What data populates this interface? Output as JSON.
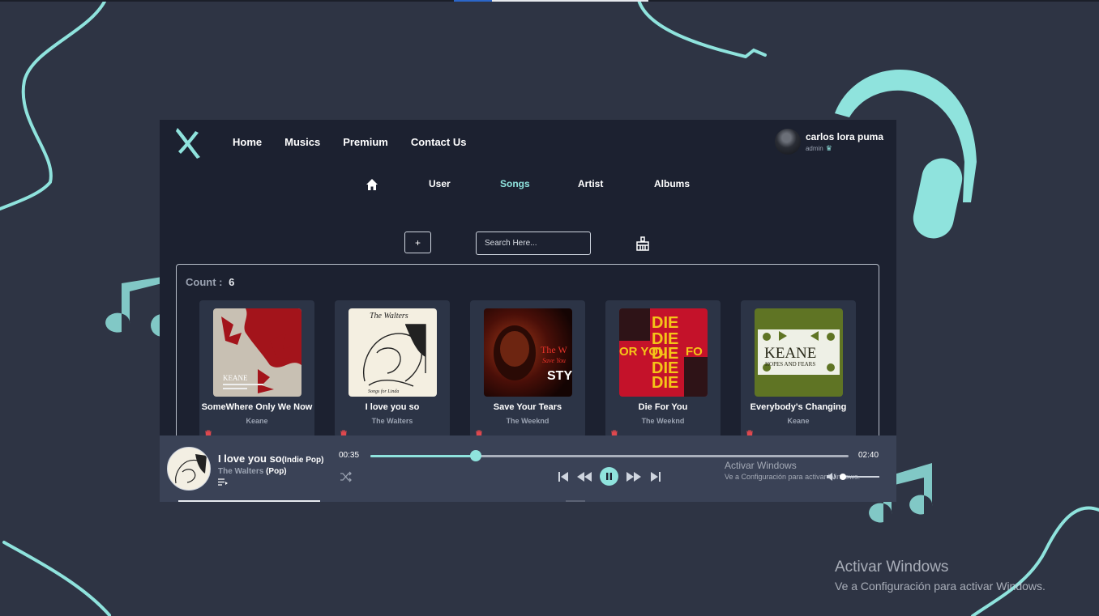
{
  "colors": {
    "accent": "#8fe3dd",
    "background": "#2e3444",
    "app_bg": "#1c2130",
    "player_bg": "#3a4256",
    "card_bg": "#2c3446"
  },
  "header": {
    "logo_icon": "x-brush-logo-icon",
    "nav": [
      "Home",
      "Musics",
      "Premium",
      "Contact Us"
    ],
    "user": {
      "name": "carlos lora puma",
      "role": "admin",
      "role_icon": "crown-icon"
    }
  },
  "subnav": {
    "home_icon": "home-icon",
    "items": [
      "User",
      "Songs",
      "Artist",
      "Albums"
    ],
    "active": "Songs"
  },
  "toolbar": {
    "add_label": "+",
    "search_placeholder": "Search Here...",
    "clear_icon": "broom-icon"
  },
  "songs": {
    "count_label": "Count :",
    "count": "6",
    "cards": [
      {
        "title": "SomeWhere Only We Now",
        "artist": "Keane"
      },
      {
        "title": "I love you so",
        "artist": "The Walters"
      },
      {
        "title": "Save Your Tears",
        "artist": "The Weeknd"
      },
      {
        "title": "Die For You",
        "artist": "The Weeknd"
      },
      {
        "title": "Everybody's Changing",
        "artist": "Keane"
      }
    ]
  },
  "player": {
    "title": "I love you so",
    "title_genre": "(Indie Pop)",
    "artist": "The Walters",
    "artist_genre": "(Pop)",
    "current_time": "00:35",
    "total_time": "02:40",
    "progress": 0.22,
    "volume": 0.0,
    "state": "playing"
  },
  "watermark": {
    "line1": "Activar Windows",
    "line2": "Ve a Configuración para activar Windows."
  }
}
